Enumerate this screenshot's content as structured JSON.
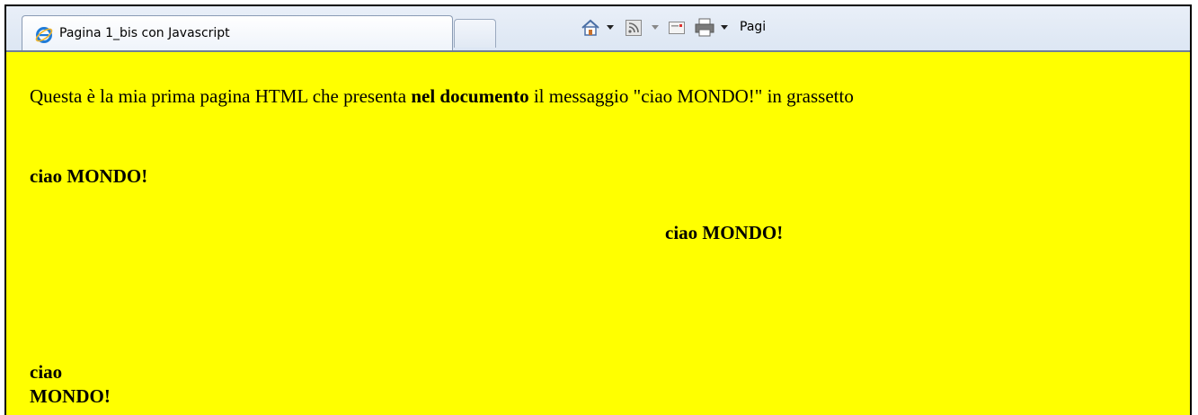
{
  "tab": {
    "title": "Pagina 1_bis con Javascript",
    "icon": "internet-explorer-icon"
  },
  "toolbar": {
    "home_icon": "home-icon",
    "feeds_icon": "rss-feed-icon",
    "mail_icon": "read-mail-icon",
    "print_icon": "print-icon",
    "page_label": "Pagi"
  },
  "document": {
    "intro_before": "Questa è la mia prima pagina HTML che presenta ",
    "intro_bold": "nel documento",
    "intro_after": " il messaggio \"ciao MONDO!\" in grassetto",
    "message_1": "ciao MONDO!",
    "message_2": "ciao MONDO!",
    "message_3_line1": "ciao",
    "message_3_line2": "MONDO!"
  },
  "colors": {
    "page_background": "#ffff00",
    "tab_strip": "#dce6f3"
  }
}
